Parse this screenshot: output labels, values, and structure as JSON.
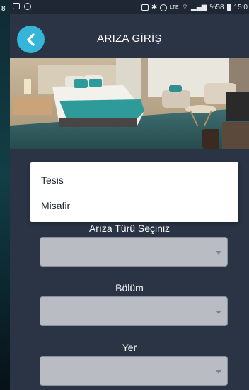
{
  "status_bar": {
    "left_edge_digit": "8",
    "battery_percent": "%58",
    "time": "15:0",
    "network": "LTE"
  },
  "header": {
    "title": "ARIZA GİRİŞ",
    "back_icon": "chevron-left-icon"
  },
  "hero": {
    "icon": "hotel-room-photo"
  },
  "dropdown": {
    "options": [
      "Tesis",
      "Misafir"
    ]
  },
  "form": {
    "fault_type_label": "Arıza Türü Seçiniz",
    "department_label": "Bölüm",
    "location_label": "Yer",
    "fault_type_value": "",
    "department_value": "",
    "location_value": ""
  },
  "colors": {
    "background": "#2a3445",
    "accent": "#35b6d8",
    "select_fill": "#b9bdc3"
  }
}
